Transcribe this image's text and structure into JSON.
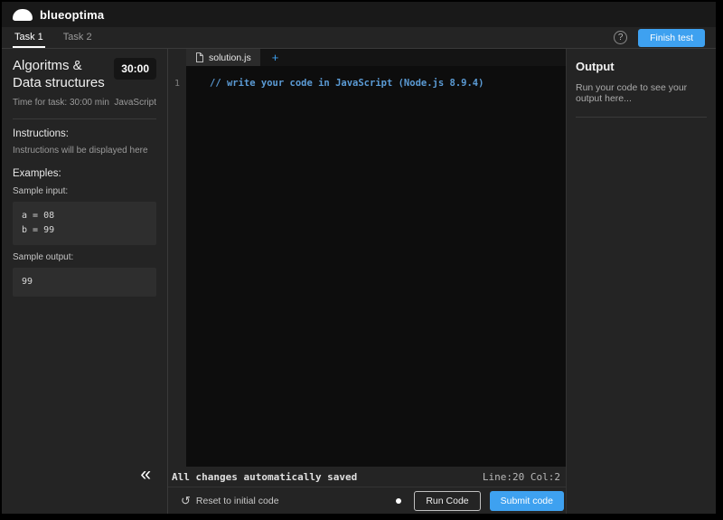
{
  "header": {
    "brand": "blueoptima"
  },
  "task_tabs": {
    "task1": "Task 1",
    "task2": "Task 2"
  },
  "topbar": {
    "help_icon": "?",
    "finish_button": "Finish test"
  },
  "sidebar": {
    "title": "Algoritms & Data structures",
    "timer": "30:00",
    "time_for_task": "Time for task: 30:00 min",
    "language": "JavaScript",
    "instructions_heading": "Instructions:",
    "instructions_text": "Instructions will be displayed here",
    "examples_heading": "Examples:",
    "sample_input_label": "Sample input:",
    "sample_input_lines": [
      "a = 08",
      "b = 99"
    ],
    "sample_output_label": "Sample output:",
    "sample_output": "99",
    "collapse_icon": "«"
  },
  "editor": {
    "file_tab": "solution.js",
    "add_tab": "+",
    "line_number": "1",
    "code_line": "// write your code in JavaScript (Node.js 8.9.4)",
    "status_saved": "All changes automatically saved",
    "cursor_position": "Line:20 Col:2",
    "reset_icon": "↺",
    "reset_label": "Reset to initial code",
    "run_button": "Run Code",
    "submit_button": "Submit code"
  },
  "output_panel": {
    "title": "Output",
    "placeholder": "Run your code to see your output here..."
  },
  "colors": {
    "accent_blue": "#3ea1f0",
    "comment_blue": "#5b9bd5",
    "page_bg": "#242424",
    "editor_bg": "#0d0d0d",
    "header_bg": "#191919"
  }
}
